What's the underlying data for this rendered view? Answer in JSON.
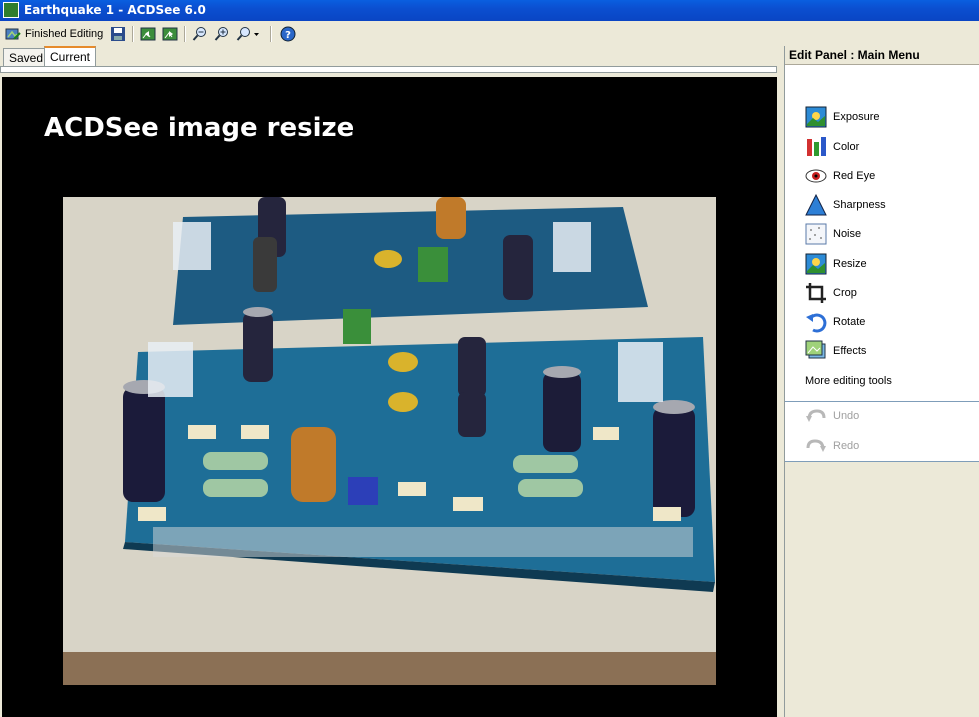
{
  "window": {
    "title": "Earthquake 1 - ACDSee 6.0"
  },
  "toolbar": {
    "finished_editing": "Finished Editing"
  },
  "tabs": [
    {
      "label": "Saved"
    },
    {
      "label": "Current"
    }
  ],
  "canvas": {
    "caption": "ACDSee image resize"
  },
  "panel": {
    "title": "Edit Panel : Main Menu",
    "items": [
      {
        "label": "Exposure",
        "icon": "exposure-icon"
      },
      {
        "label": "Color",
        "icon": "color-icon"
      },
      {
        "label": "Red Eye",
        "icon": "red-eye-icon"
      },
      {
        "label": "Sharpness",
        "icon": "sharpness-icon"
      },
      {
        "label": "Noise",
        "icon": "noise-icon"
      },
      {
        "label": "Resize",
        "icon": "resize-icon"
      },
      {
        "label": "Crop",
        "icon": "crop-icon"
      },
      {
        "label": "Rotate",
        "icon": "rotate-icon"
      },
      {
        "label": "Effects",
        "icon": "effects-icon"
      }
    ],
    "more": "More editing tools",
    "undo": "Undo",
    "redo": "Redo"
  }
}
